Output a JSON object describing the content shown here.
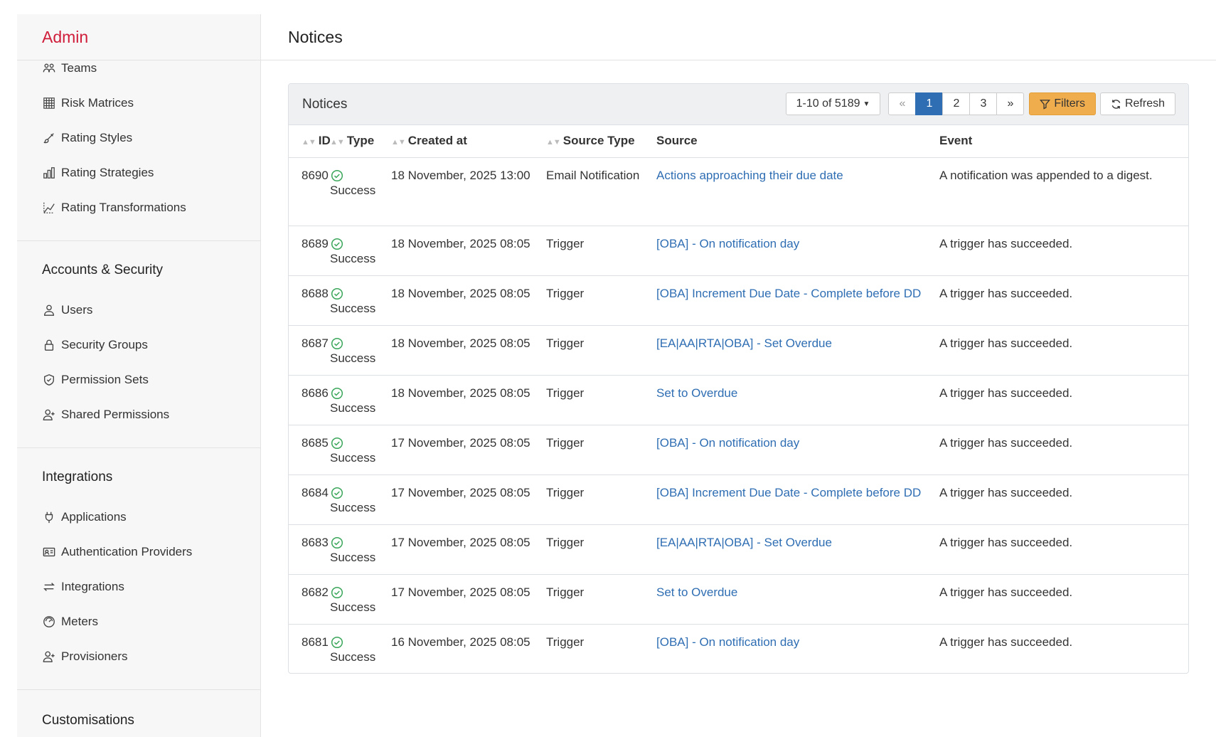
{
  "sidebar": {
    "brand": "Admin",
    "top_items": [
      {
        "label": "Teams",
        "icon": "teams-icon"
      },
      {
        "label": "Risk Matrices",
        "icon": "grid-icon"
      },
      {
        "label": "Rating Styles",
        "icon": "brush-icon"
      },
      {
        "label": "Rating Strategies",
        "icon": "strategies-icon"
      },
      {
        "label": "Rating Transformations",
        "icon": "transform-icon"
      }
    ],
    "groups": [
      {
        "title": "Accounts & Security",
        "items": [
          {
            "label": "Users",
            "icon": "user-icon"
          },
          {
            "label": "Security Groups",
            "icon": "lock-icon"
          },
          {
            "label": "Permission Sets",
            "icon": "shield-check-icon"
          },
          {
            "label": "Shared Permissions",
            "icon": "user-plus-icon"
          }
        ]
      },
      {
        "title": "Integrations",
        "items": [
          {
            "label": "Applications",
            "icon": "plug-icon"
          },
          {
            "label": "Authentication Providers",
            "icon": "id-card-icon"
          },
          {
            "label": "Integrations",
            "icon": "arrows-swap-icon"
          },
          {
            "label": "Meters",
            "icon": "meter-icon"
          },
          {
            "label": "Provisioners",
            "icon": "user-plus-icon"
          }
        ]
      },
      {
        "title": "Customisations",
        "items": []
      }
    ]
  },
  "header": {
    "title": "Notices"
  },
  "panel": {
    "title": "Notices",
    "range_label": "1-10 of 5189",
    "pager": {
      "first": "«",
      "pages": [
        "1",
        "2",
        "3"
      ],
      "active_page": "1",
      "last": "»"
    },
    "filters_label": "Filters",
    "refresh_label": "Refresh"
  },
  "table": {
    "columns": [
      "ID",
      "Type",
      "Created at",
      "Source Type",
      "Source",
      "Event"
    ],
    "rows": [
      {
        "id": "8690",
        "type": "Success",
        "created": "18 November, 2025 13:00",
        "source_type": "Email Notification",
        "source": "Actions approaching their due date",
        "event": "A notification was appended to a digest."
      },
      {
        "id": "8689",
        "type": "Success",
        "created": "18 November, 2025 08:05",
        "source_type": "Trigger",
        "source": "[OBA] - On notification day",
        "event": "A trigger has succeeded."
      },
      {
        "id": "8688",
        "type": "Success",
        "created": "18 November, 2025 08:05",
        "source_type": "Trigger",
        "source": "[OBA] Increment Due Date - Complete before DD",
        "event": "A trigger has succeeded."
      },
      {
        "id": "8687",
        "type": "Success",
        "created": "18 November, 2025 08:05",
        "source_type": "Trigger",
        "source": "[EA|AA|RTA|OBA] - Set Overdue",
        "event": "A trigger has succeeded."
      },
      {
        "id": "8686",
        "type": "Success",
        "created": "18 November, 2025 08:05",
        "source_type": "Trigger",
        "source": "Set to Overdue",
        "event": "A trigger has succeeded."
      },
      {
        "id": "8685",
        "type": "Success",
        "created": "17 November, 2025 08:05",
        "source_type": "Trigger",
        "source": "[OBA] - On notification day",
        "event": "A trigger has succeeded."
      },
      {
        "id": "8684",
        "type": "Success",
        "created": "17 November, 2025 08:05",
        "source_type": "Trigger",
        "source": "[OBA] Increment Due Date - Complete before DD",
        "event": "A trigger has succeeded."
      },
      {
        "id": "8683",
        "type": "Success",
        "created": "17 November, 2025 08:05",
        "source_type": "Trigger",
        "source": "[EA|AA|RTA|OBA] - Set Overdue",
        "event": "A trigger has succeeded."
      },
      {
        "id": "8682",
        "type": "Success",
        "created": "17 November, 2025 08:05",
        "source_type": "Trigger",
        "source": "Set to Overdue",
        "event": "A trigger has succeeded."
      },
      {
        "id": "8681",
        "type": "Success",
        "created": "16 November, 2025 08:05",
        "source_type": "Trigger",
        "source": "[OBA] - On notification day",
        "event": "A trigger has succeeded."
      }
    ]
  },
  "colors": {
    "brand": "#cf1d3a",
    "link": "#2f6eb3",
    "success": "#3aa65a",
    "filters": "#f0ad4e",
    "active_page": "#2f6eb3"
  }
}
